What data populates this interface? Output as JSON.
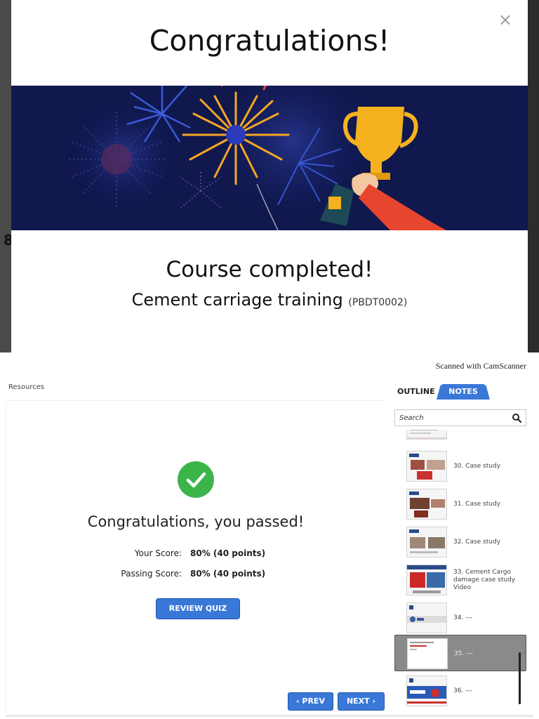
{
  "modal": {
    "title": "Congratulations!",
    "close_symbol": "×",
    "course_status": "Course completed!",
    "course_name": "Cement carriage training",
    "course_code": "(PBDT0002)",
    "banner_icons": [
      "fireworks-icon",
      "trophy-icon"
    ]
  },
  "left_edge_fragment": "8",
  "watermark": "Scanned with CamScanner",
  "player": {
    "resources_label": "Resources",
    "result_title": "Congratulations, you passed!",
    "your_score_label": "Your Score:",
    "your_score_value": "80% (40 points)",
    "passing_score_label": "Passing Score:",
    "passing_score_value": "80% (40 points)",
    "review_button": "REVIEW QUIZ",
    "prev_button": "‹ PREV",
    "next_button": "NEXT ›"
  },
  "sidebar": {
    "tab_outline": "OUTLINE",
    "tab_notes": "NOTES",
    "search_placeholder": "Search",
    "slides": [
      {
        "label": "",
        "selected": false
      },
      {
        "label": "30. Case study",
        "selected": false
      },
      {
        "label": "31. Case study",
        "selected": false
      },
      {
        "label": "32. Case study",
        "selected": false
      },
      {
        "label": "33. Cement Cargo damage case study Video",
        "selected": false
      },
      {
        "label": "34. ---",
        "selected": false
      },
      {
        "label": "35. ---",
        "selected": true
      },
      {
        "label": "36. ---",
        "selected": false
      }
    ]
  },
  "colors": {
    "accent_blue": "#3a78d8",
    "success_green": "#3bb54a",
    "banner_navy": "#10184e",
    "selected_row": "#8a8a8a"
  }
}
